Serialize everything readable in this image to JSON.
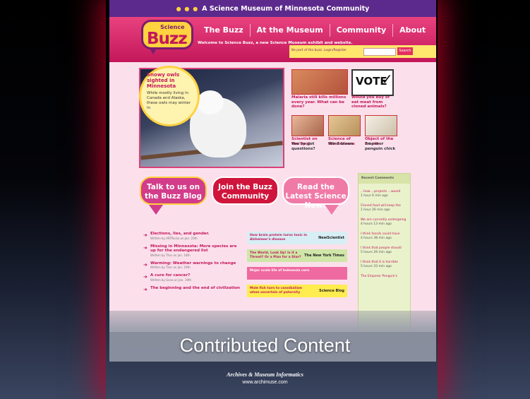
{
  "site": {
    "top_banner": "A Science Museum of Minnesota Community",
    "logo_small": "Science",
    "logo_big": "Buzz",
    "nav": [
      "The Buzz",
      "At the Museum",
      "Community",
      "About"
    ],
    "welcome": "Welcome to Science Buzz, a new Science Museum exhibit and website.",
    "login_line": "Be part of the buzz.  Login/Register",
    "search_button": "Search"
  },
  "hero": {
    "title": "Snowy owls sighted in Minnesota",
    "summary": "While mostly living in Canada and Alaska, these owls may winter in"
  },
  "features": [
    {
      "title": "Malaria still kills millions every year. What can be done?",
      "sub": ""
    },
    {
      "title": "Would you buy or eat meat from cloned animals?",
      "sub": ""
    },
    {
      "title": "Scientist on the Spot",
      "sub": "You've got questions?"
    },
    {
      "title": "Science of the Seasons",
      "sub": "Wind blows"
    },
    {
      "title": "Object of the month",
      "sub": "Emperor penguin chick"
    }
  ],
  "vote_label": "VOTE",
  "bubbles": [
    {
      "text": "Talk to us on the Buzz Blog",
      "color": "#d23c8a"
    },
    {
      "text": "Join the Buzz Community",
      "color": "#d0153c"
    },
    {
      "text": "Read the Latest Science News",
      "color": "#f07aa6"
    }
  ],
  "blog_posts": [
    {
      "title": "Elections, lies, and gender.",
      "meta": "Written by ARTPacko on Jan. 20th"
    },
    {
      "title": "Missing in Minnesota: More species are up for the endangered list",
      "meta": "Written by Thor on Jan. 18th"
    },
    {
      "title": "Warming: Weather warnings to change",
      "meta": "Written by Thor on Jan. 19th"
    },
    {
      "title": "A cure for cancer?",
      "meta": "Written by Gena on Jan. 19th"
    },
    {
      "title": "The beginning and the end of civilization",
      "meta": ""
    }
  ],
  "news_items": [
    {
      "title": "How brain protein turns toxic in Alzheimer's disease",
      "source": "NewScientist",
      "color": "#d7eef4"
    },
    {
      "title": "The World, Look Up! Is it a Threat? Or a Plan for a Star?",
      "source": "The New York Times",
      "color": "#cfe6a8"
    },
    {
      "title": "Major scale life of Indonesia corn",
      "source": "",
      "color": "#ef6aa0"
    },
    {
      "title": "Male fish turn to cannibalism when uncertain of paternity",
      "source": "Science Blog",
      "color": "#ffec4f"
    }
  ],
  "recent_comments": {
    "header": "Recent Comments",
    "items": [
      {
        "title": "...how ...projects ...would",
        "time": "1 hour 6 min ago"
      },
      {
        "title": "Cloned food will keep the",
        "time": "1 hour 26 min ago"
      },
      {
        "title": "We are currently undergoing",
        "time": "4 hours 13 min ago"
      },
      {
        "title": "I think fossils could have",
        "time": "4 hours 38 min ago"
      },
      {
        "title": "I think that people should",
        "time": "5 hours 26 min ago"
      },
      {
        "title": "I think that it is horrible",
        "time": "5 hours 33 min ago"
      },
      {
        "title": "The Emperor Penguin's",
        "time": ""
      }
    ]
  },
  "slide": {
    "title": "Contributed Content",
    "footer_org": "Archives & Museum Informatics",
    "footer_url": "www.archimuse.com"
  }
}
